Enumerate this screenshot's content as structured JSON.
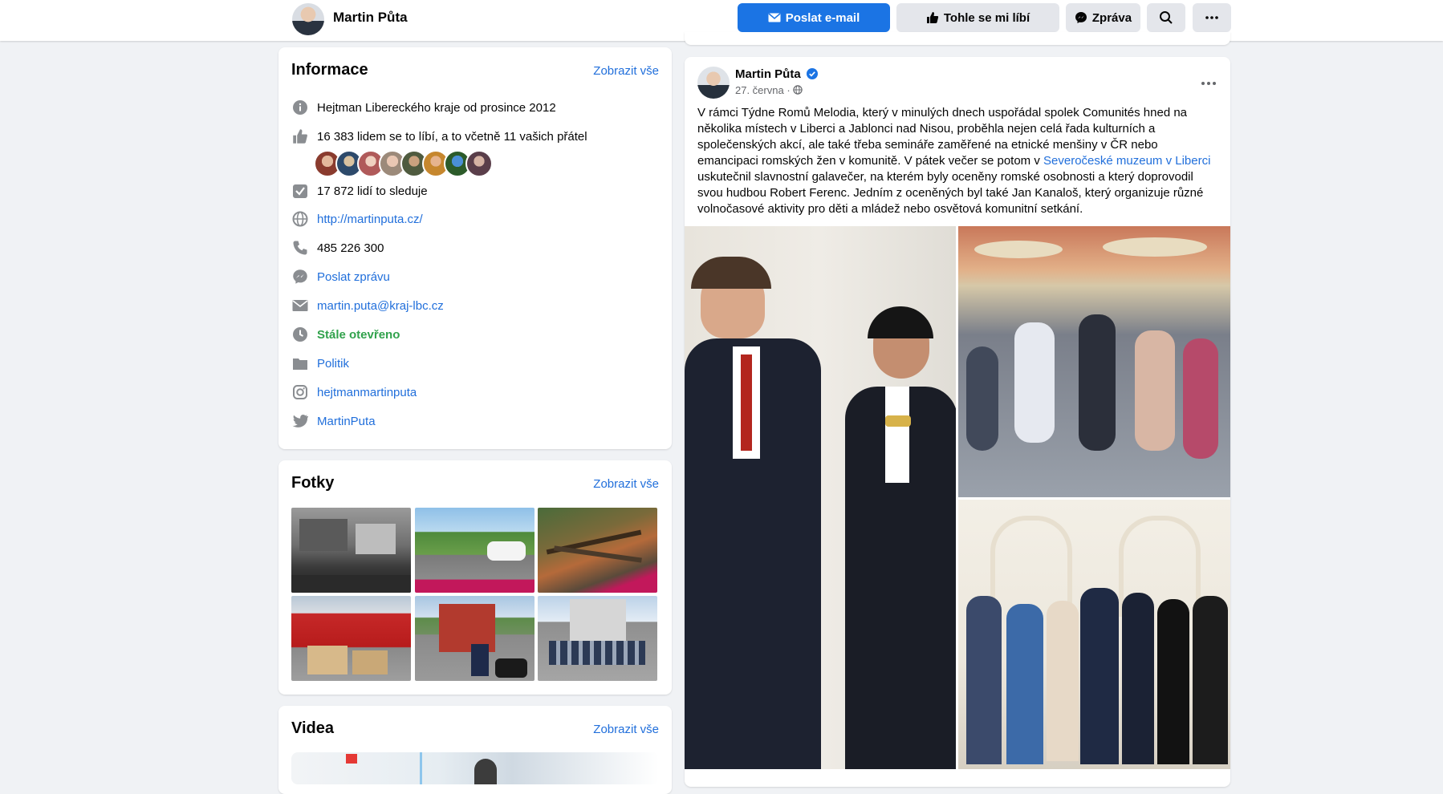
{
  "header": {
    "page_name": "Martin Půta",
    "email_button": "Poslat e-mail",
    "like_button": "Tohle se mi líbí",
    "message_button": "Zpráva"
  },
  "info": {
    "title": "Informace",
    "see_all": "Zobrazit vše",
    "rows": [
      {
        "icon": "info-icon",
        "text": "Hejtman Libereckého kraje od prosince 2012"
      },
      {
        "icon": "like-icon",
        "text": "16 383 lidem se to líbí, a to včetně 11 vašich přátel"
      },
      {
        "icon": "follow-icon",
        "text": "17 872 lidí to sleduje"
      },
      {
        "icon": "globe-icon",
        "text": "http://martinputa.cz/"
      },
      {
        "icon": "phone-icon",
        "text": "485 226 300"
      },
      {
        "icon": "messenger-icon",
        "text": "Poslat zprávu"
      },
      {
        "icon": "email-icon",
        "text": "martin.puta@kraj-lbc.cz"
      },
      {
        "icon": "clock-icon",
        "text": "Stále otevřeno"
      },
      {
        "icon": "category-icon",
        "text": "Politik"
      },
      {
        "icon": "instagram-icon",
        "text": "hejtmanmartinputa"
      },
      {
        "icon": "twitter-icon",
        "text": "MartinPuta"
      }
    ]
  },
  "photos": {
    "title": "Fotky",
    "see_all": "Zobrazit vše"
  },
  "videos": {
    "title": "Videa",
    "see_all": "Zobrazit vše"
  },
  "post": {
    "author": "Martin Půta",
    "date": "27. června",
    "text_before_link": "V rámci Týdne Romů Melodia, který v minulých dnech uspořádal spolek Comunités hned na několika místech v Liberci a Jablonci nad Nisou, proběhla nejen celá řada kulturních a společenských akcí, ale také třeba semináře zaměřené na etnické menšiny v ČR nebo emancipaci romských žen v komunitě. V pátek večer se potom v ",
    "link_text": "Severočeské muzeum v Liberci",
    "text_after_link": " uskutečnil slavnostní galavečer, na kterém byly oceněny romské osobnosti a který doprovodil svou hudbou Robert Ferenc. Jedním z oceněných byl také Jan Kanaloš, který organizuje různé volnočasové aktivity pro děti a mládež nebo osvětová komunitní setkání."
  },
  "colors": {
    "accent": "#1b74e4",
    "link": "#216fdb",
    "open_green": "#31a24c",
    "verified": "#1b74e4"
  }
}
